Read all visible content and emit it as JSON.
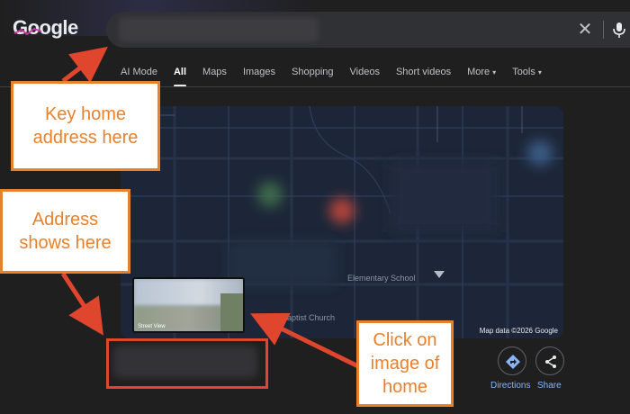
{
  "header": {
    "logo_text": "Google",
    "clear_icon": "close-icon",
    "mic_icon": "mic-icon"
  },
  "tabs": [
    {
      "label": "AI Mode",
      "active": false
    },
    {
      "label": "All",
      "active": true
    },
    {
      "label": "Maps",
      "active": false
    },
    {
      "label": "Images",
      "active": false
    },
    {
      "label": "Shopping",
      "active": false
    },
    {
      "label": "Videos",
      "active": false
    },
    {
      "label": "Short videos",
      "active": false
    },
    {
      "label": "More",
      "active": false,
      "caret": "▾"
    },
    {
      "label": "Tools",
      "active": false,
      "caret": "▾"
    }
  ],
  "map": {
    "school_label": "Elementary School",
    "church_label": "tmont Baptist Church",
    "copyright": "Map data ©2026 Google",
    "street_view_label": "Street View"
  },
  "actions": {
    "directions_label": "Directions",
    "share_label": "Share",
    "directions_icon": "directions-icon",
    "share_icon": "share-icon"
  },
  "annotations": {
    "callout_search": [
      "Key home",
      "address here"
    ],
    "callout_address": [
      "Address",
      "shows here"
    ],
    "callout_image": [
      "Click on",
      "image of",
      "home"
    ],
    "accent_color": "#e8812b",
    "arrow_color": "#e0452d"
  }
}
